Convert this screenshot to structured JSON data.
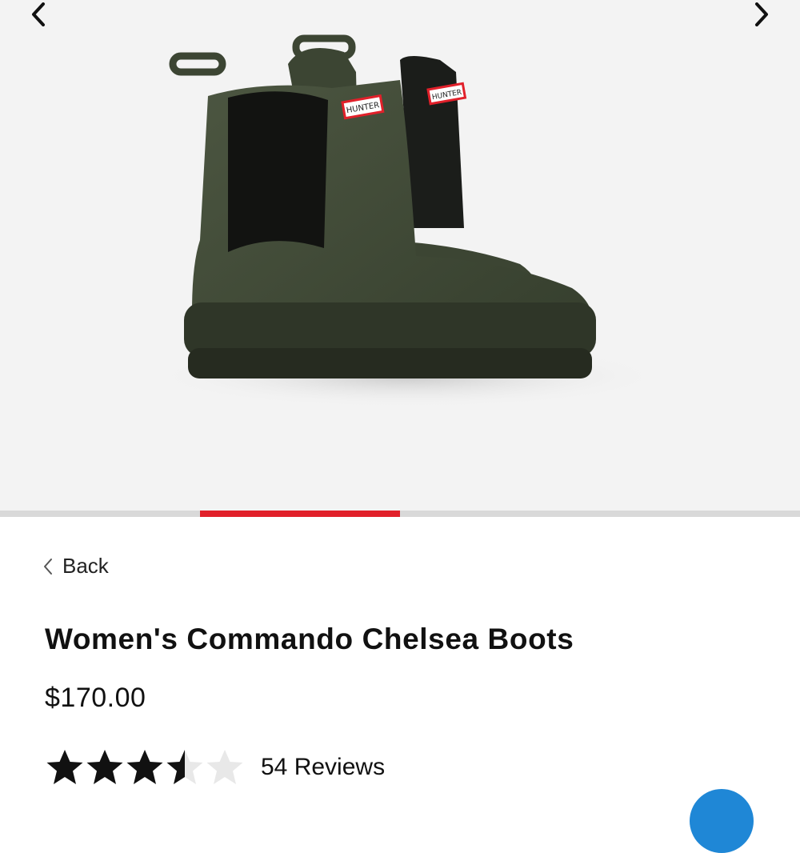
{
  "gallery": {
    "prev_icon": "chevron-left-icon",
    "next_icon": "chevron-right-icon",
    "image_alt": "Women's Commando Chelsea Boots",
    "brand_tag": "HUNTER",
    "progress_fraction": 0.25,
    "progress_color": "#e1202a"
  },
  "nav": {
    "back_label": "Back"
  },
  "product": {
    "title": "Women's Commando Chelsea Boots",
    "price": "$170.00",
    "rating_value": 3.5,
    "rating_max": 5,
    "reviews_label": "54 Reviews"
  },
  "chat": {
    "icon": "chat-icon",
    "color": "#1f87d6"
  }
}
